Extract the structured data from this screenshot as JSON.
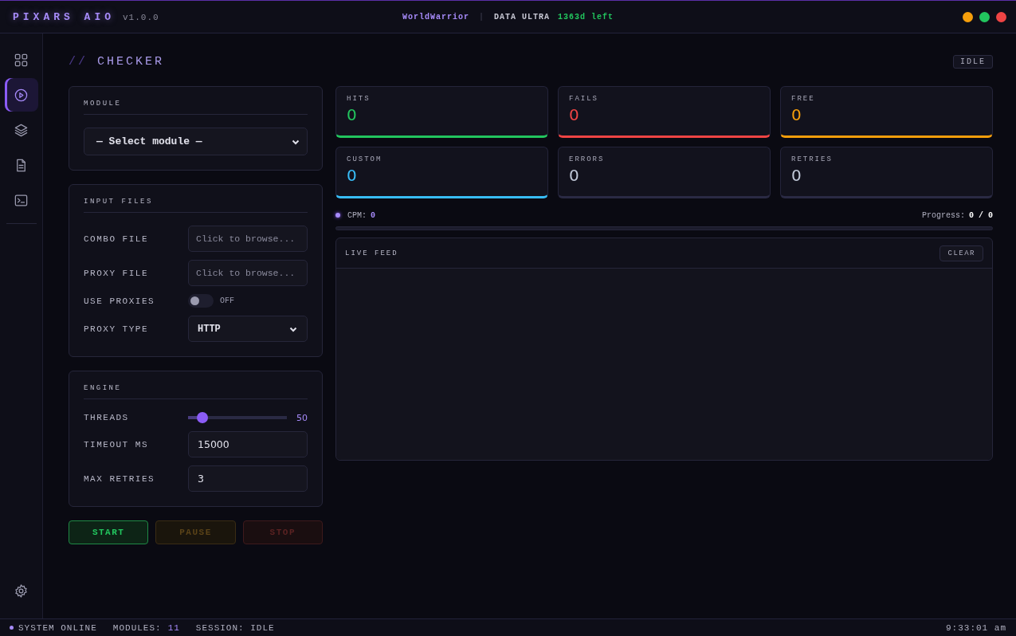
{
  "titlebar": {
    "app_name": "PIXARS AIO",
    "version": "v1.0.0",
    "user": "WorldWarrior",
    "separator": "|",
    "plan": "DATA ULTRA",
    "remaining": "1363d left",
    "window_controls": [
      {
        "color": "#f59e0b"
      },
      {
        "color": "#22c55e"
      },
      {
        "color": "#ef4444"
      }
    ]
  },
  "sidebar": {
    "items": [
      {
        "kind": "dashboard",
        "selected": false
      },
      {
        "kind": "checker",
        "selected": true
      },
      {
        "kind": "modules",
        "selected": false
      },
      {
        "kind": "files",
        "selected": false
      },
      {
        "kind": "console",
        "selected": false
      }
    ],
    "bottom_items": [
      {
        "kind": "settings",
        "selected": false
      }
    ]
  },
  "header": {
    "prefix": "//",
    "title": "CHECKER",
    "status_badge": "IDLE"
  },
  "panels": [
    {
      "title": "MODULE",
      "rows": [
        {
          "kind": "select",
          "value": "— Select module —"
        }
      ]
    },
    {
      "title": "INPUT FILES",
      "rows": [
        {
          "kind": "file",
          "label": "COMBO FILE",
          "placeholder": "Click to browse..."
        },
        {
          "kind": "file",
          "label": "PROXY FILE",
          "placeholder": "Click to browse..."
        },
        {
          "kind": "toggle",
          "label": "USE PROXIES",
          "on": false,
          "state_text": "OFF"
        },
        {
          "kind": "select",
          "label": "PROXY TYPE",
          "value": "HTTP"
        }
      ]
    },
    {
      "title": "ENGINE",
      "rows": [
        {
          "kind": "slider",
          "label": "THREADS",
          "level": 0.1,
          "reading": "50"
        },
        {
          "kind": "number",
          "label": "TIMEOUT MS",
          "value": "15000"
        },
        {
          "kind": "number",
          "label": "MAX RETRIES",
          "value": "3"
        }
      ]
    }
  ],
  "buttons": [
    {
      "kind": "start",
      "label": "START",
      "disabled": false
    },
    {
      "kind": "pause",
      "label": "PAUSE",
      "disabled": true
    },
    {
      "kind": "stop",
      "label": "STOP",
      "disabled": true
    }
  ],
  "stats": [
    {
      "label": "HITS",
      "value": "0",
      "color": "#22c55e"
    },
    {
      "label": "FAILS",
      "value": "0",
      "color": "#ef4444"
    },
    {
      "label": "FREE",
      "value": "0",
      "color": "#f59e0b"
    },
    {
      "label": "CUSTOM",
      "value": "0",
      "color": "#38bdf8"
    },
    {
      "label": "ERRORS",
      "value": "0",
      "color": "#2a2a44"
    },
    {
      "label": "RETRIES",
      "value": "0",
      "color": "#2a2a44"
    }
  ],
  "rate": {
    "label": "CPM:",
    "value": "0"
  },
  "progress": {
    "label": "Progress:",
    "value": "0 / 0",
    "level": 0
  },
  "live_feed": {
    "title": "LIVE FEED",
    "clear_button": "CLEAR"
  },
  "status_bar": {
    "status": "SYSTEM ONLINE",
    "modules_label": "MODULES:",
    "modules_value": "11",
    "session": "SESSION: IDLE",
    "time": "9:33:01 am"
  }
}
